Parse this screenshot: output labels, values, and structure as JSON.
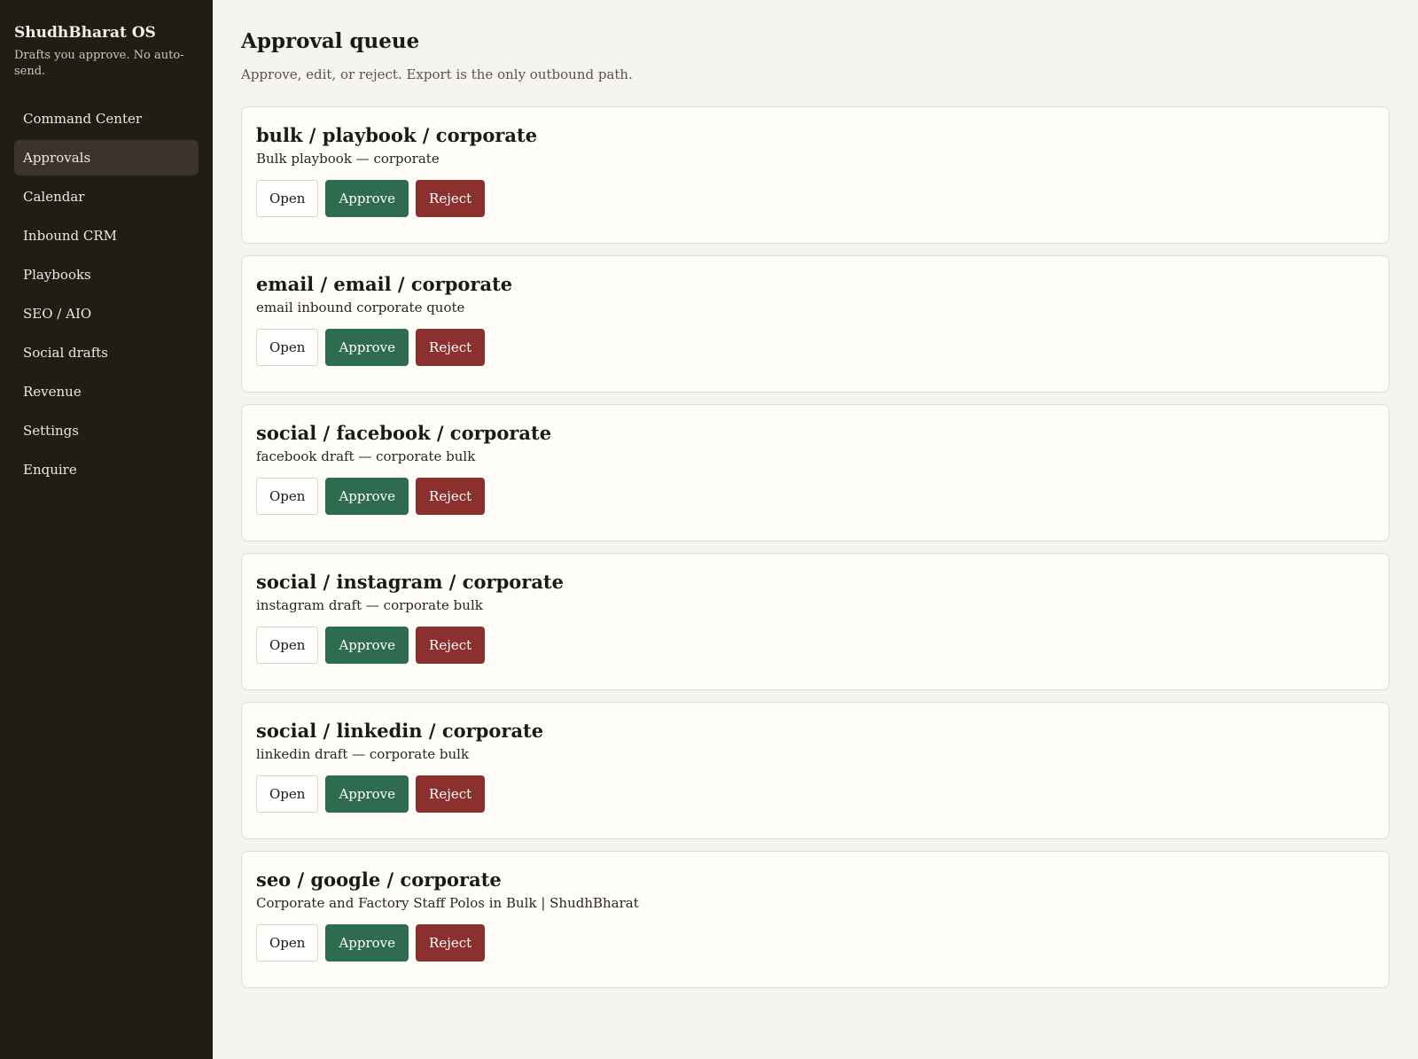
{
  "sidebar": {
    "brand": "ShudhBharat OS",
    "tagline": "Drafts you approve. No auto-send.",
    "items": [
      {
        "label": "Command Center"
      },
      {
        "label": "Approvals"
      },
      {
        "label": "Calendar"
      },
      {
        "label": "Inbound CRM"
      },
      {
        "label": "Playbooks"
      },
      {
        "label": "SEO / AIO"
      },
      {
        "label": "Social drafts"
      },
      {
        "label": "Revenue"
      },
      {
        "label": "Settings"
      },
      {
        "label": "Enquire"
      }
    ],
    "active_item": "Approvals"
  },
  "main": {
    "title": "Approval queue",
    "subtitle": "Approve, edit, or reject. Export is the only outbound path.",
    "buttons": {
      "open": "Open",
      "approve": "Approve",
      "reject": "Reject"
    },
    "queue": [
      {
        "title": "bulk / playbook / corporate",
        "description": "Bulk playbook — corporate"
      },
      {
        "title": "email / email / corporate",
        "description": "email inbound corporate quote"
      },
      {
        "title": "social / facebook / corporate",
        "description": "facebook draft — corporate bulk"
      },
      {
        "title": "social / instagram / corporate",
        "description": "instagram draft — corporate bulk"
      },
      {
        "title": "social / linkedin / corporate",
        "description": "linkedin draft — corporate bulk"
      },
      {
        "title": "seo / google / corporate",
        "description": "Corporate and Factory Staff Polos in Bulk | ShudhBharat"
      }
    ]
  },
  "colors": {
    "sidebar_bg": "#201c16",
    "page_bg": "#f6f4ef",
    "approve": "#2f6b4f",
    "reject": "#8c2f2f"
  }
}
